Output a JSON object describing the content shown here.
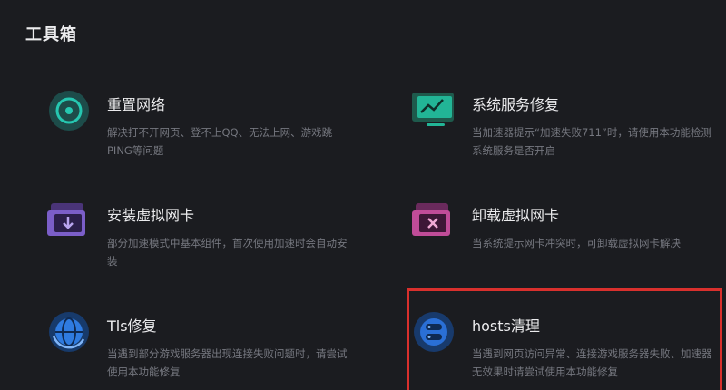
{
  "page": {
    "title": "工具箱"
  },
  "tools": [
    {
      "name": "重置网络",
      "desc": "解决打不开网页、登不上QQ、无法上网、游戏跳PING等问题",
      "icon": "reset-network-icon"
    },
    {
      "name": "系统服务修复",
      "desc": "当加速器提示“加速失败711”时，请使用本功能检测系统服务是否开启",
      "icon": "system-service-repair-icon"
    },
    {
      "name": "安装虚拟网卡",
      "desc": "部分加速模式中基本组件，首次使用加速时会自动安装",
      "icon": "install-virtual-nic-icon"
    },
    {
      "name": "卸载虚拟网卡",
      "desc": "当系统提示网卡冲突时，可卸载虚拟网卡解决",
      "icon": "uninstall-virtual-nic-icon"
    },
    {
      "name": "Tls修复",
      "desc": "当遇到部分游戏服务器出现连接失败问题时，请尝试使用本功能修复",
      "icon": "tls-repair-icon"
    },
    {
      "name": "hosts清理",
      "desc": "当遇到网页访问异常、连接游戏服务器失败、加速器无效果时请尝试使用本功能修复",
      "icon": "hosts-clean-icon"
    }
  ],
  "colors": {
    "background": "#1b1c20",
    "highlight": "#d9302d",
    "teal": "#1fb8a3",
    "purple": "#7e5cc7",
    "blue": "#2f7be0",
    "pink": "#c84f9c"
  }
}
